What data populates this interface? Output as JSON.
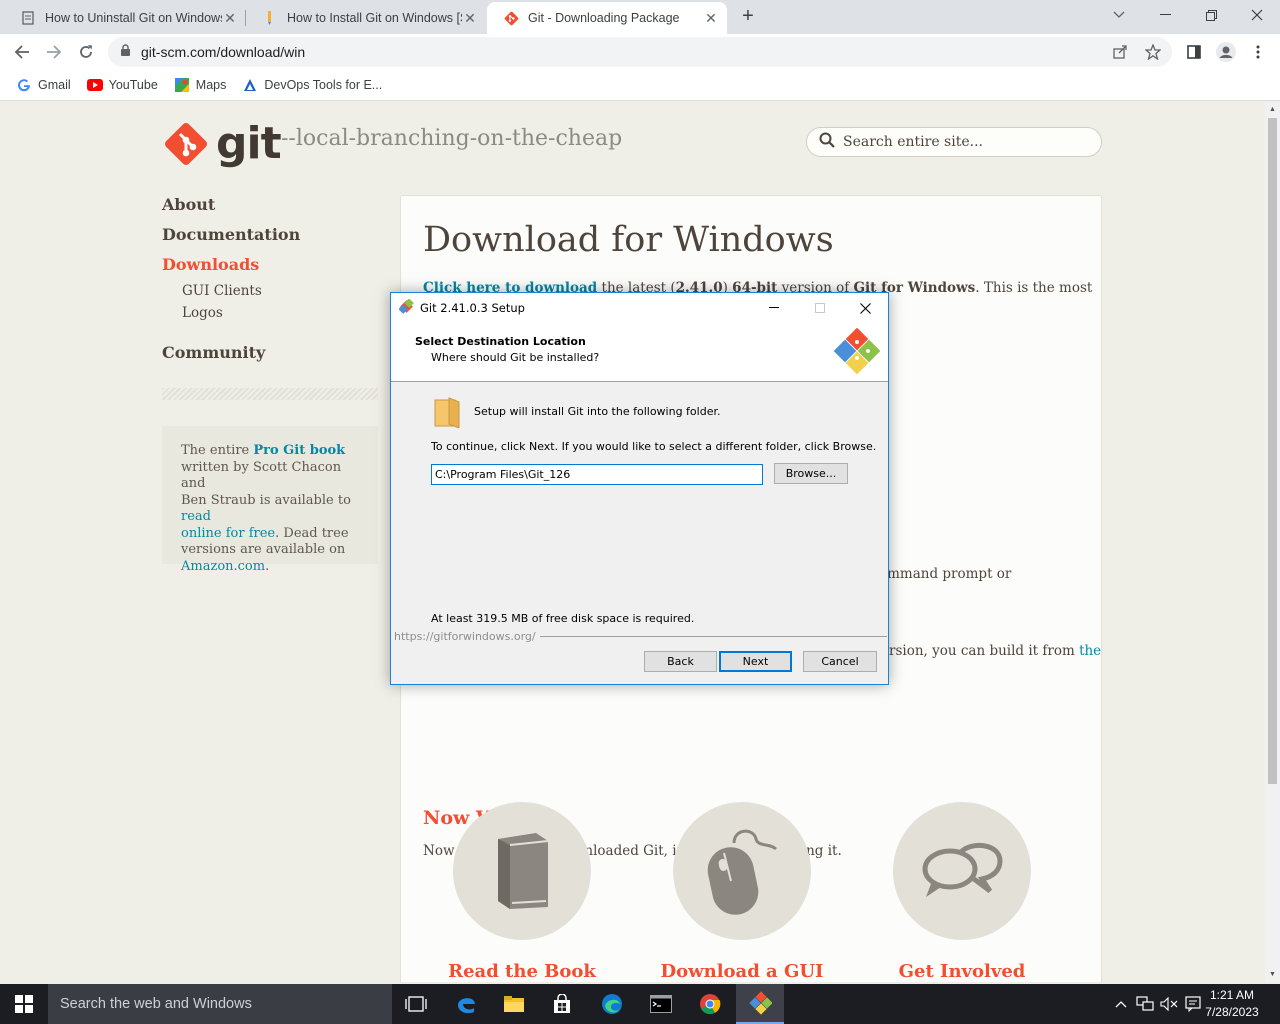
{
  "browser": {
    "tabs": [
      {
        "title": "How to Uninstall Git on Windows",
        "icon": "page-icon"
      },
      {
        "title": "How to Install Git on Windows [S",
        "icon": "pencil-favicon"
      },
      {
        "title": "Git - Downloading Package",
        "icon": "git-favicon"
      }
    ],
    "new_tab": "+",
    "url": "git-scm.com/download/win",
    "bookmarks": [
      {
        "label": "Gmail",
        "icon": "google-icon"
      },
      {
        "label": "YouTube",
        "icon": "youtube-icon"
      },
      {
        "label": "Maps",
        "icon": "maps-icon"
      },
      {
        "label": "DevOps Tools for E...",
        "icon": "devops-icon"
      }
    ]
  },
  "site": {
    "logo_text": "git",
    "tagline": "--local-branching-on-the-cheap",
    "search_placeholder": "Search entire site...",
    "nav": {
      "about": "About",
      "documentation": "Documentation",
      "downloads": "Downloads",
      "gui_clients": "GUI Clients",
      "logos": "Logos",
      "community": "Community"
    },
    "book": {
      "t1": "The entire ",
      "link1": "Pro Git book",
      "t2": "written by Scott Chacon and",
      "t3": "Ben Straub is available to ",
      "link2a": "read",
      "link2b": "online for free",
      "t4": ". Dead tree",
      "t5": "versions are available on",
      "link3": "Amazon.com",
      "t6": "."
    },
    "main": {
      "heading": "Download for Windows",
      "intro_link": "Click here to download",
      "intro_t1": " the latest (",
      "intro_version": "2.41.0",
      "intro_t2": ") ",
      "intro_bits": "64-bit",
      "intro_t3": " version of ",
      "intro_product": "Git for Windows",
      "intro_t4": ". This is the most",
      "frag1": "ommand prompt or",
      "frag2": "rsion, you can build it from ",
      "frag2_link": "the",
      "now_what": "Now What?",
      "now_text": "Now that you have downloaded Git, it's time to start using it.",
      "features": [
        {
          "label": "Read the Book",
          "icon": "book-icon"
        },
        {
          "label": "Download a GUI",
          "icon": "mouse-icon"
        },
        {
          "label": "Get Involved",
          "icon": "chat-bubbles-icon"
        }
      ]
    }
  },
  "dialog": {
    "title": "Git 2.41.0.3 Setup",
    "header_title": "Select Destination Location",
    "header_sub": "Where should Git be installed?",
    "install_text": "Setup will install Git into the following folder.",
    "continue_text": "To continue, click Next. If you would like to select a different folder, click Browse.",
    "path_value": "C:\\Program Files\\Git_126",
    "browse": "Browse...",
    "disk_space": "At least 319.5 MB of free disk space is required.",
    "footer_link": "https://gitforwindows.org/",
    "back": "Back",
    "next": "Next",
    "cancel": "Cancel"
  },
  "taskbar": {
    "search": "Search the web and Windows",
    "time": "1:21 AM",
    "date": "7/28/2023"
  },
  "colors": {
    "git_orange": "#f14e32",
    "link_teal": "#0388a6",
    "win_accent": "#0078d7"
  }
}
